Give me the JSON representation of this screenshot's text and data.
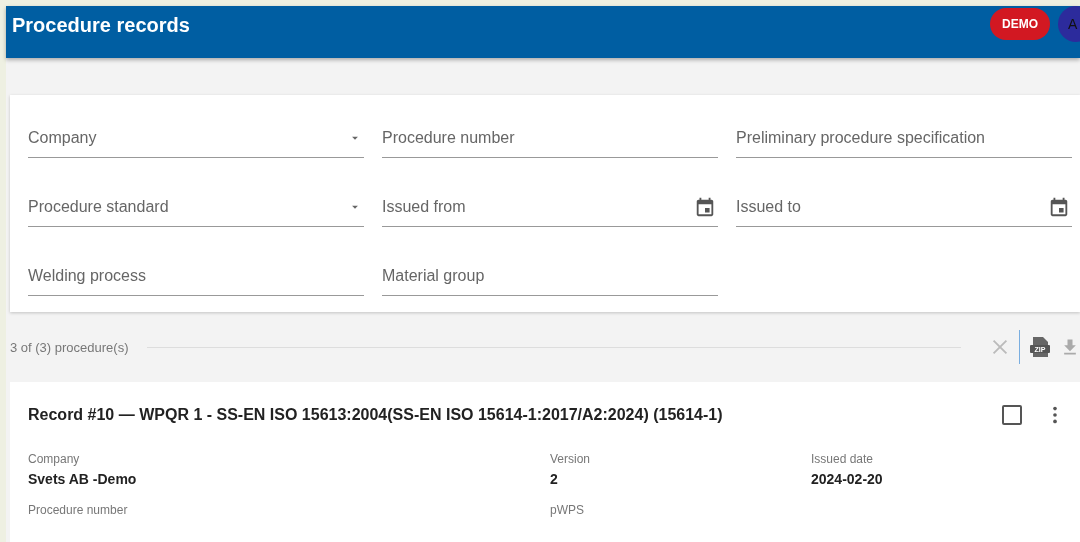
{
  "header": {
    "title": "Procedure records",
    "badge": "DEMO",
    "avatar": "A"
  },
  "filters": [
    {
      "label": "Company",
      "kind": "select"
    },
    {
      "label": "Procedure number",
      "kind": "text"
    },
    {
      "label": "Preliminary procedure specification",
      "kind": "text"
    },
    {
      "label": "Procedure standard",
      "kind": "select"
    },
    {
      "label": "Issued from",
      "kind": "date"
    },
    {
      "label": "Issued to",
      "kind": "date"
    },
    {
      "label": "Welding process",
      "kind": "text"
    },
    {
      "label": "Material group",
      "kind": "text"
    }
  ],
  "results": {
    "count": "3 of (3) procedure(s)",
    "zip_label": "ZIP"
  },
  "record": {
    "title": "Record #10 — WPQR 1 - SS-EN ISO 15613:2004(SS-EN ISO 15614-1:2017/A2:2024) (15614-1)",
    "checked": false,
    "fields": [
      {
        "label": "Company",
        "value": "Svets AB -Demo"
      },
      {
        "label": "Version",
        "value": "2"
      },
      {
        "label": "Issued date",
        "value": "2024-02-20"
      },
      {
        "label": "Procedure number"
      },
      {
        "label": "pWPS"
      }
    ]
  }
}
